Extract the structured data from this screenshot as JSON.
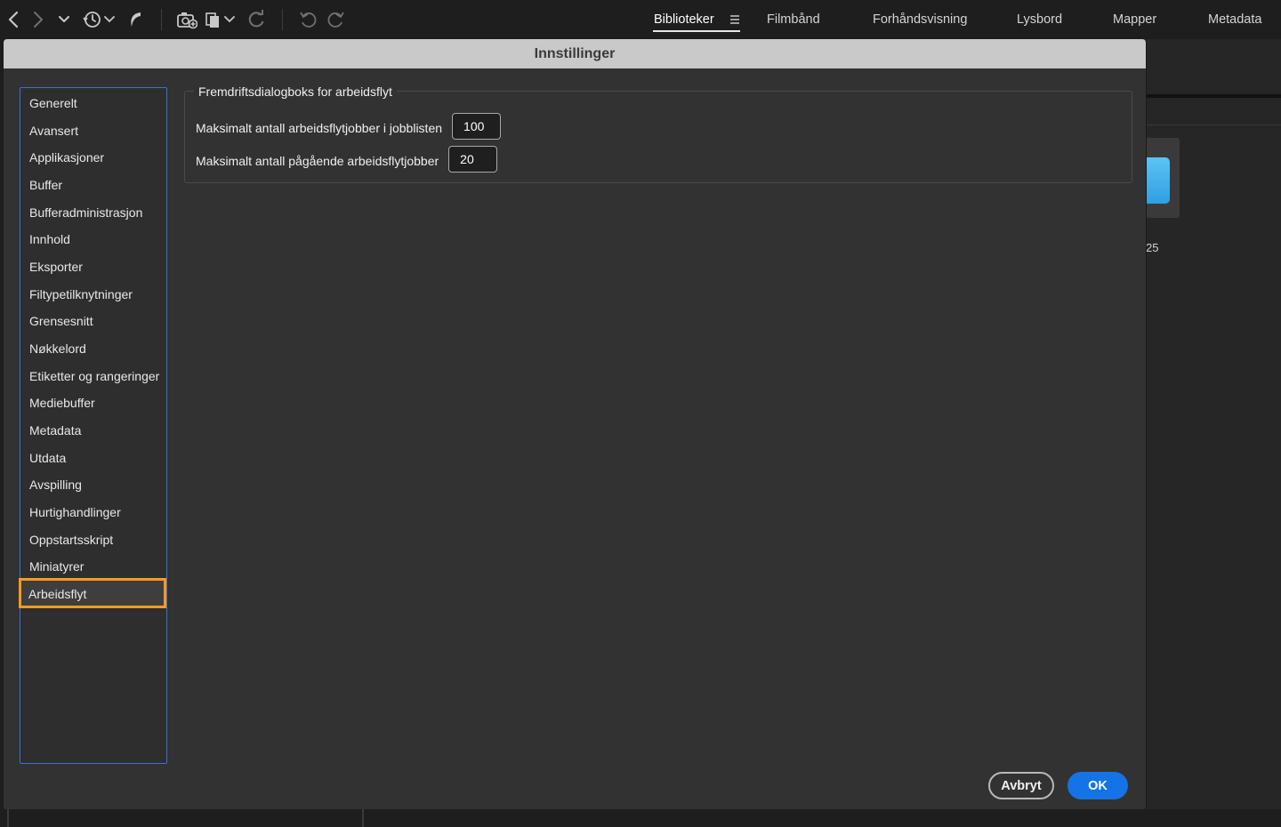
{
  "toolbar": {
    "icons": [
      "back-icon",
      "forward-icon",
      "chevron-down-icon",
      "history-icon",
      "boomerang-icon",
      "camera-import-icon",
      "copy-stack-icon",
      "refresh-icon",
      "undo-icon",
      "redo-icon"
    ]
  },
  "nav": {
    "tabs": [
      {
        "label": "Biblioteker",
        "active": true
      },
      {
        "label": "Filmbånd",
        "active": false
      },
      {
        "label": "Forhåndsvisning",
        "active": false
      },
      {
        "label": "Lysbord",
        "active": false
      },
      {
        "label": "Mapper",
        "active": false
      },
      {
        "label": "Metadata",
        "active": false
      }
    ]
  },
  "background": {
    "item_count": "25"
  },
  "dialog": {
    "title": "Innstillinger",
    "categories": [
      "Generelt",
      "Avansert",
      "Applikasjoner",
      "Buffer",
      "Bufferadministrasjon",
      "Innhold",
      "Eksporter",
      "Filtypetilknytninger",
      "Grensesnitt",
      "Nøkkelord",
      "Etiketter og rangeringer",
      "Mediebuffer",
      "Metadata",
      "Utdata",
      "Avspilling",
      "Hurtighandlinger",
      "Oppstartsskript",
      "Miniatyrer",
      "Arbeidsflyt"
    ],
    "selected_category": "Arbeidsflyt",
    "group": {
      "legend": "Fremdriftsdialogboks for arbeidsflyt",
      "fields": [
        {
          "label": "Maksimalt antall arbeidsflytjobber i jobblisten",
          "value": "100"
        },
        {
          "label": "Maksimalt antall pågående arbeidsflytjobber",
          "value": "20"
        }
      ]
    },
    "buttons": {
      "cancel": "Avbryt",
      "ok": "OK"
    }
  },
  "colors": {
    "accent_blue": "#1473e6",
    "selection_outline": "#ff9a1f",
    "list_border": "#3b6fd6"
  }
}
